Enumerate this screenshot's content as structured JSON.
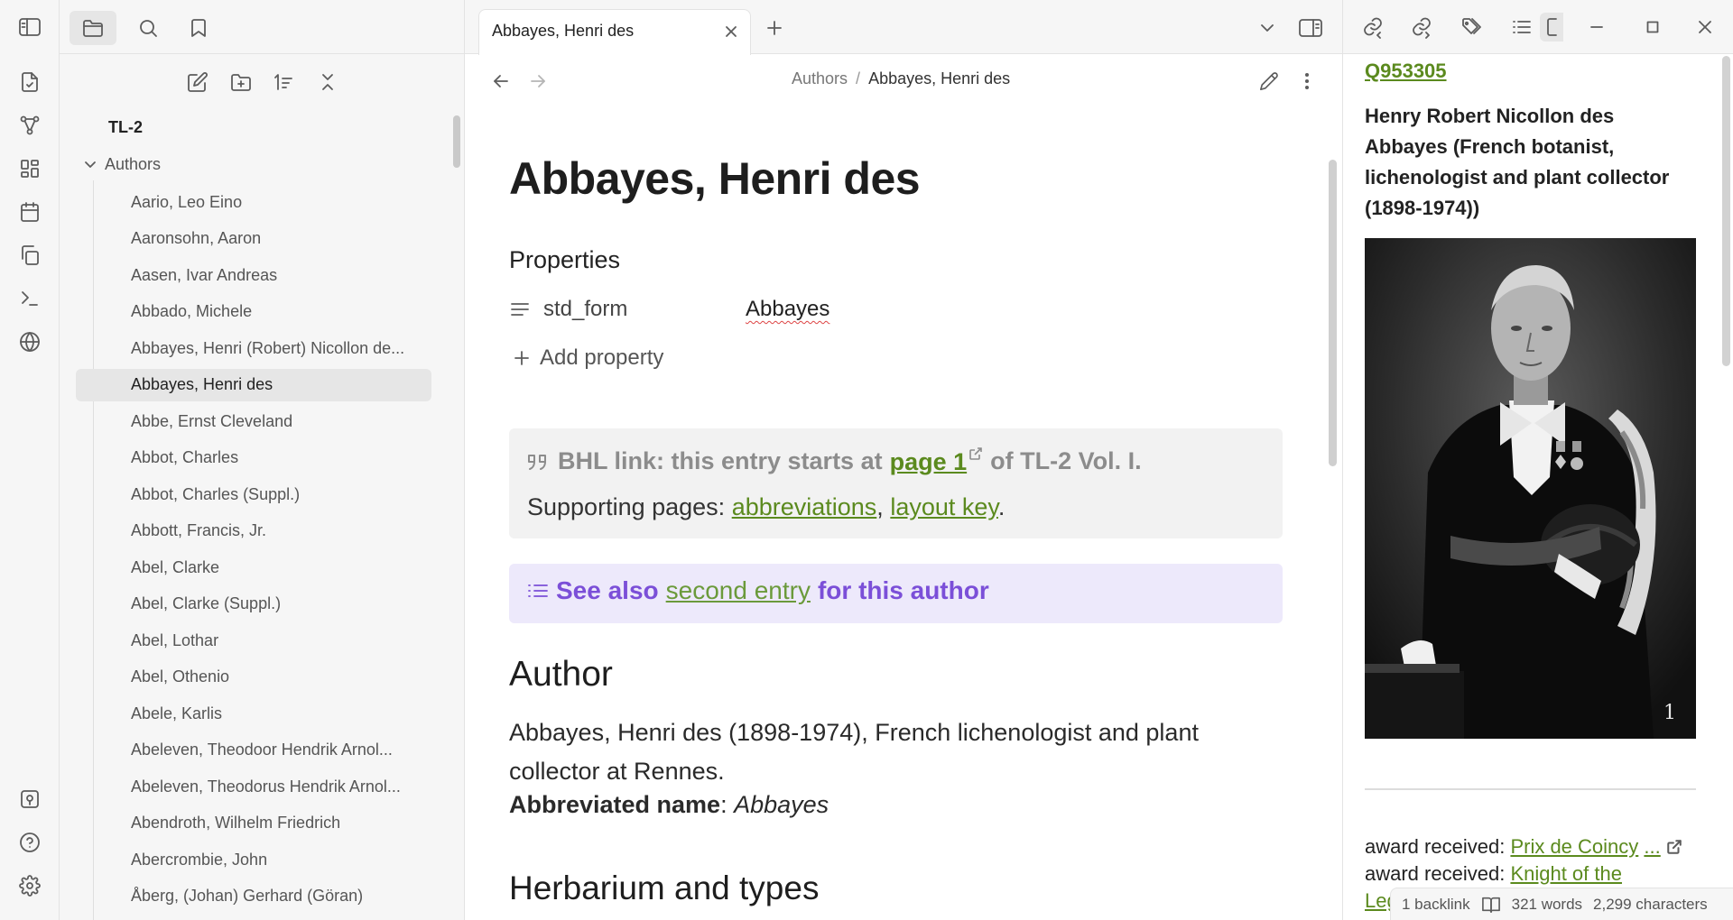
{
  "sidebar": {
    "vault_name": "TL-2",
    "folder": "Authors",
    "files": [
      "Aario, Leo Eino",
      "Aaronsohn, Aaron",
      "Aasen, Ivar Andreas",
      "Abbado, Michele",
      "Abbayes, Henri (Robert) Nicollon de...",
      "Abbayes, Henri des",
      "Abbe, Ernst Cleveland",
      "Abbot, Charles",
      "Abbot, Charles (Suppl.)",
      "Abbott, Francis, Jr.",
      "Abel, Clarke",
      "Abel, Clarke (Suppl.)",
      "Abel, Lothar",
      "Abel, Othenio",
      "Abele, Karlis",
      "Abeleven, Theodoor Hendrik Arnol...",
      "Abeleven, Theodorus Hendrik Arnol...",
      "Abendroth, Wilhelm Friedrich",
      "Abercrombie, John",
      "Åberg, (Johan) Gerhard (Göran)"
    ],
    "active_index": 5
  },
  "tab": {
    "title": "Abbayes, Henri des"
  },
  "header": {
    "breadcrumb_folder": "Authors",
    "breadcrumb_sep": "/",
    "breadcrumb_current": "Abbayes, Henri des"
  },
  "note": {
    "title": "Abbayes, Henri des",
    "properties_heading": "Properties",
    "property_key": "std_form",
    "property_value": "Abbayes",
    "add_property": "Add property",
    "bhl_prefix": "BHL link: this entry starts at",
    "bhl_link": "page 1",
    "bhl_suffix": "of TL-2 Vol. I.",
    "supporting_prefix": "Supporting pages:",
    "supporting_link1": "abbreviations",
    "supporting_comma": ",",
    "supporting_link2": "layout key",
    "supporting_period": ".",
    "see_also_prefix": "See also",
    "see_also_link": "second entry",
    "see_also_suffix": "for this author",
    "author_heading": "Author",
    "author_text": "Abbayes, Henri des (1898-1974), French lichenologist and plant collector at Rennes.",
    "abbr_label": "Abbreviated name",
    "abbr_colon": ":",
    "abbr_value": "Abbayes",
    "herbarium_heading": "Herbarium and types"
  },
  "right_pane": {
    "qid": "Q953305",
    "description": "Henry Robert Nicollon des Abbayes (French botanist, lichenologist and plant collector (1898-1974))",
    "portrait_number": "1",
    "award1_label": "award received:",
    "award1_link": "Prix de Coincy",
    "award1_more": "...",
    "award2_label": "award received:",
    "award2_link": "Knight of the",
    "award2_cont": "Leg"
  },
  "status": {
    "backlinks": "1 backlink",
    "words": "321 words",
    "characters": "2,299 characters"
  }
}
